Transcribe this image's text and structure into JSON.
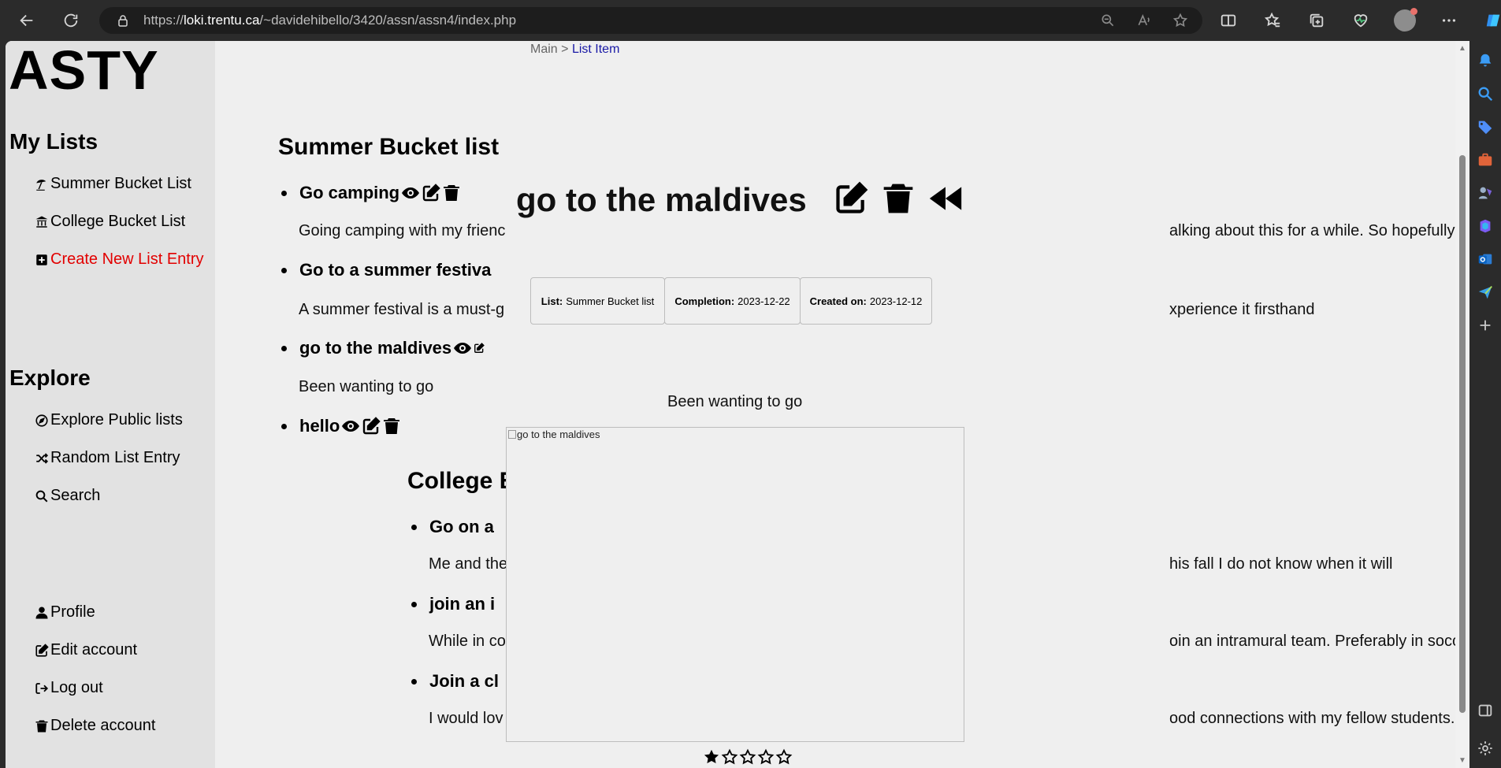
{
  "browser": {
    "url_prefix": "https://",
    "url_host": "loki.trentu.ca",
    "url_path": "/~davidehibello/3420/assn/assn4/index.php"
  },
  "sidebar": {
    "brand": "ASTY",
    "my_lists_heading": "My Lists",
    "my_lists": [
      {
        "label": "Summer Bucket List",
        "icon": "umbrella-beach-icon"
      },
      {
        "label": "College Bucket List",
        "icon": "building-columns-icon"
      },
      {
        "label": "Create New List Entry",
        "icon": "plus-square-icon"
      }
    ],
    "explore_heading": "Explore",
    "explore": [
      {
        "label": "Explore Public lists",
        "icon": "compass-icon"
      },
      {
        "label": "Random List Entry",
        "icon": "shuffle-icon"
      },
      {
        "label": "Search",
        "icon": "search-icon"
      }
    ],
    "account": [
      {
        "label": "Profile",
        "icon": "user-icon"
      },
      {
        "label": "Edit account",
        "icon": "edit-icon"
      },
      {
        "label": "Log out",
        "icon": "logout-icon"
      },
      {
        "label": "Delete account",
        "icon": "trash-icon"
      }
    ],
    "create_color": "#e20000"
  },
  "breadcrumb": {
    "root": "Main",
    "separator": ">",
    "current": "List Item"
  },
  "lists": {
    "summer": {
      "title": "Summer Bucket list",
      "entries": [
        {
          "title": "Go camping",
          "desc": "Going camping with my frienc"
        },
        {
          "title": "Go to a summer festiva",
          "desc": "A summer festival is a must-g"
        },
        {
          "title": "go to the maldives",
          "desc": "Been wanting to go"
        },
        {
          "title": "hello",
          "desc": ""
        }
      ],
      "desc_tails": [
        "alking about this for a while. So hopefully we finally get to do it",
        "xperience it firsthand"
      ]
    },
    "college": {
      "title": "College E",
      "entries": [
        {
          "title": "Go on a",
          "desc": "Me and the",
          "tail": "his fall I do not know when it will"
        },
        {
          "title": "join an i",
          "desc": "While in co",
          "tail": "oin an intramural team. Preferably in soccer."
        },
        {
          "title": "Join a cl",
          "desc": "I would lov",
          "tail": "ood connections with my fellow students."
        }
      ]
    }
  },
  "item": {
    "title": "go to the maldives",
    "list_label": "List:",
    "list_value": "Summer Bucket list",
    "completion_label": "Completion:",
    "completion_value": "2023-12-22",
    "created_label": "Created on:",
    "created_value": "2023-12-12",
    "description": "Been wanting to go",
    "image_alt": "go to the maldives",
    "rating": 1,
    "rating_max": 5
  }
}
